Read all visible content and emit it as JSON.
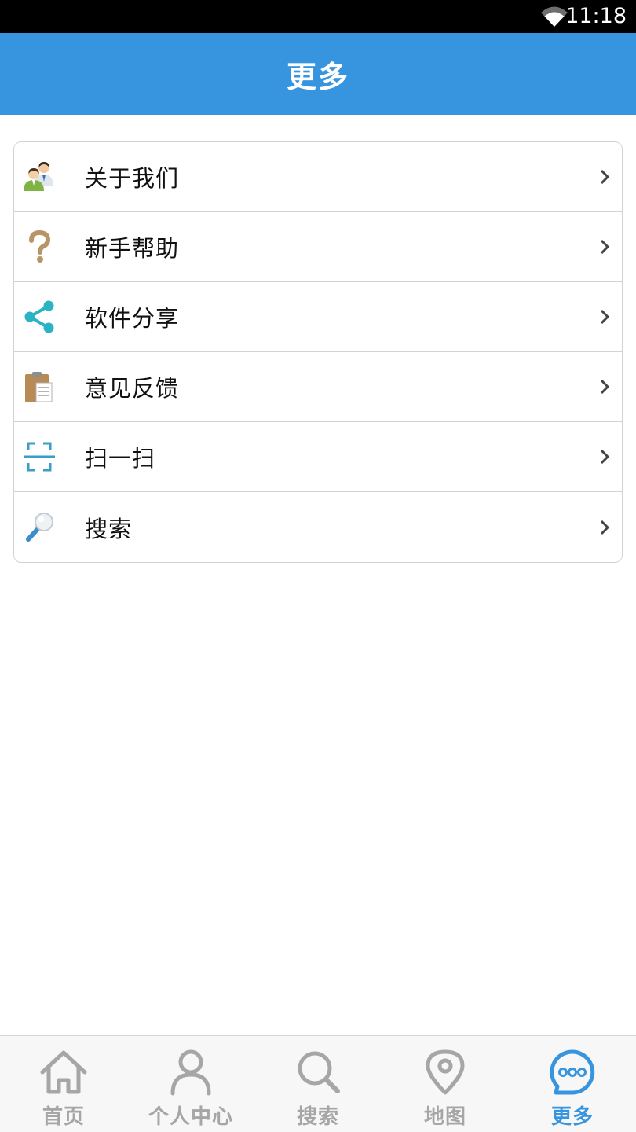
{
  "status_bar": {
    "time": "11:18",
    "icons": [
      "wifi-icon"
    ]
  },
  "header": {
    "title": "更多"
  },
  "menu": {
    "items": [
      {
        "label": "关于我们",
        "icon": "users-icon"
      },
      {
        "label": "新手帮助",
        "icon": "question-icon"
      },
      {
        "label": "软件分享",
        "icon": "share-icon"
      },
      {
        "label": "意见反馈",
        "icon": "clipboard-icon"
      },
      {
        "label": "扫一扫",
        "icon": "scan-icon"
      },
      {
        "label": "搜索",
        "icon": "magnifier-icon"
      }
    ]
  },
  "tab_bar": {
    "tabs": [
      {
        "label": "首页",
        "icon": "home-icon",
        "active": false
      },
      {
        "label": "个人中心",
        "icon": "person-icon",
        "active": false
      },
      {
        "label": "搜索",
        "icon": "search-icon",
        "active": false
      },
      {
        "label": "地图",
        "icon": "map-pin-icon",
        "active": false
      },
      {
        "label": "更多",
        "icon": "more-icon",
        "active": true
      }
    ]
  },
  "colors": {
    "accent": "#3795e0",
    "tab_inactive": "#a6a6a6",
    "divider": "#d2d2d2"
  }
}
